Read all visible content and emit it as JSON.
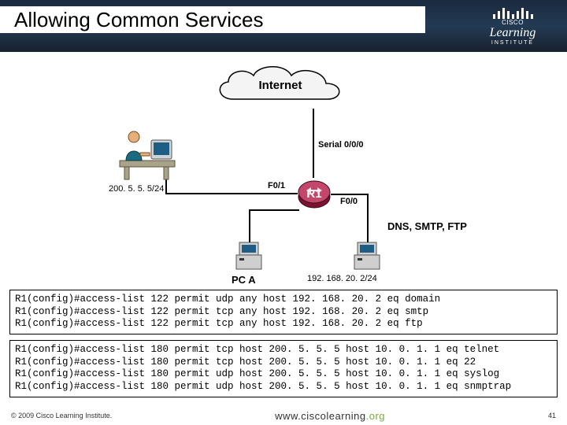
{
  "title": "Allowing Common Services",
  "logo": {
    "cisco": "CISCO",
    "learning": "Learning",
    "institute": "INSTITUTE"
  },
  "diagram": {
    "cloud": "Internet",
    "serial": "Serial 0/0/0",
    "subnet_left": "200. 5. 5. 5/24",
    "f01": "F0/1",
    "f00": "F0/0",
    "r1": "R1",
    "services": "DNS, SMTP, FTP",
    "pca": "PC A",
    "subnet_right": "192. 168. 20. 2/24"
  },
  "code1": "R1(config)#access-list 122 permit udp any host 192. 168. 20. 2 eq domain\nR1(config)#access-list 122 permit tcp any host 192. 168. 20. 2 eq smtp\nR1(config)#access-list 122 permit tcp any host 192. 168. 20. 2 eq ftp",
  "code2": "R1(config)#access-list 180 permit tcp host 200. 5. 5. 5 host 10. 0. 1. 1 eq telnet\nR1(config)#access-list 180 permit tcp host 200. 5. 5. 5 host 10. 0. 1. 1 eq 22\nR1(config)#access-list 180 permit udp host 200. 5. 5. 5 host 10. 0. 1. 1 eq syslog\nR1(config)#access-list 180 permit udp host 200. 5. 5. 5 host 10. 0. 1. 1 eq snmptrap",
  "footer": {
    "copyright": "© 2009 Cisco Learning Institute.",
    "url_prefix": "www.ciscolearning",
    "url_suffix": ".org",
    "page": "41"
  }
}
